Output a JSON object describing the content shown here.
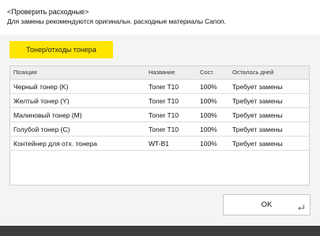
{
  "header": {
    "title": "<Проверить расходные>",
    "description": "Для замены рекомендуются оригинальн. расходные материалы Canon."
  },
  "tab": {
    "label": "Тонер/отходы тонера"
  },
  "table": {
    "columns": [
      "Позиция",
      "Название",
      "Сост.",
      "Осталось дней"
    ],
    "rows": [
      [
        "Черный тонер (K)",
        "Toner T10",
        "100%",
        "Требует замены"
      ],
      [
        "Желтый тонер (Y)",
        "Toner T10",
        "100%",
        "Требует замены"
      ],
      [
        "Малиновый тонер (M)",
        "Toner T10",
        "100%",
        "Требует замены"
      ],
      [
        "Голубой тонер (C)",
        "Toner T10",
        "100%",
        "Требует замены"
      ],
      [
        "Контейнер для отх. тонера",
        "WT-B1",
        "100%",
        "Требует замены"
      ]
    ]
  },
  "ok_button": {
    "label": "OK",
    "icon": "enter-return-icon"
  },
  "colors": {
    "tab_accent": "#ffe500",
    "background": "#f4f4f4",
    "bottom_bar": "#3c3c3c"
  }
}
